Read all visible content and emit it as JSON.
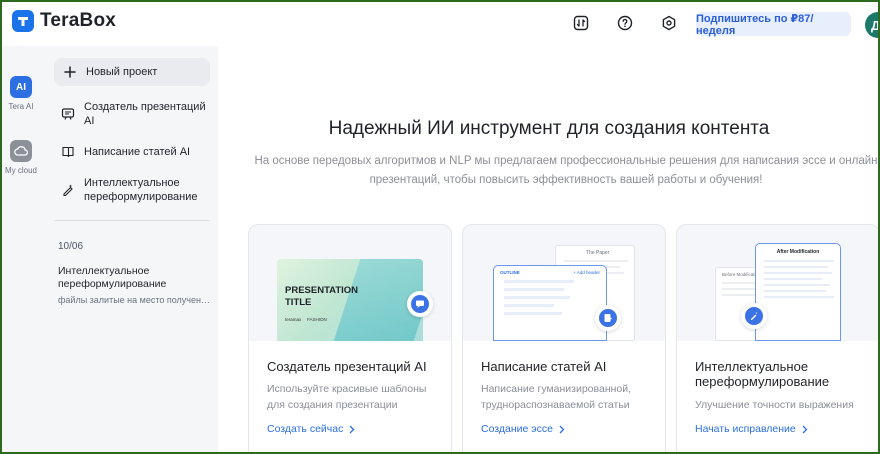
{
  "app": {
    "name": "TeraBox"
  },
  "header": {
    "subscribe_label": "Подпишитесь по ₽87/неделя",
    "avatar_initial": "Д",
    "icons": [
      "transfer-icon",
      "help-icon",
      "settings-icon"
    ]
  },
  "rail": {
    "items": [
      {
        "label": "Tera AI",
        "icon": "ai-icon",
        "active": true
      },
      {
        "label": "My cloud",
        "icon": "cloud-icon",
        "active": false
      }
    ]
  },
  "sidebar": {
    "new_project": "Новый проект",
    "items": [
      {
        "label": "Создатель презентаций AI",
        "icon": "presentation-icon"
      },
      {
        "label": "Написание статей AI",
        "icon": "article-icon"
      },
      {
        "label": "Интеллектуальное переформулирование",
        "icon": "rewrite-icon"
      }
    ],
    "history": {
      "date": "10/06",
      "title": "Интеллектуальное переформулирование",
      "subtitle": "файлы залитые на место полученные"
    }
  },
  "main": {
    "title": "Надежный ИИ инструмент для создания контента",
    "subtitle": "На основе передовых алгоритмов и NLP мы предлагаем профессиональные решения для написания эссе и онлайн презентаций, чтобы повысить эффективность вашей работы и обучения!",
    "cards": [
      {
        "title": "Создатель презентаций AI",
        "desc": "Используйте красивые шаблоны для создания презентации",
        "link": "Создать сейчас",
        "preview_title": "PRESENTATION TITLE",
        "preview_brand": "teramax",
        "preview_tag": "FASHION"
      },
      {
        "title": "Написание статей AI",
        "desc": "Написание гуманизированной, труднораспознаваемой статьи",
        "link": "Создание эссе",
        "preview_outline": "OUTLINE",
        "preview_add": "+ Add header",
        "preview_paper": "The Paper"
      },
      {
        "title": "Интеллектуальное переформулирование",
        "desc": "Улучшение точности выражения",
        "link": "Начать исправление",
        "preview_before": "Before Modification",
        "preview_after": "After Modification"
      }
    ]
  },
  "colors": {
    "accent": "#2b6fe3",
    "brand": "#1a73e8",
    "rail_bg": "#f5f6f8"
  }
}
